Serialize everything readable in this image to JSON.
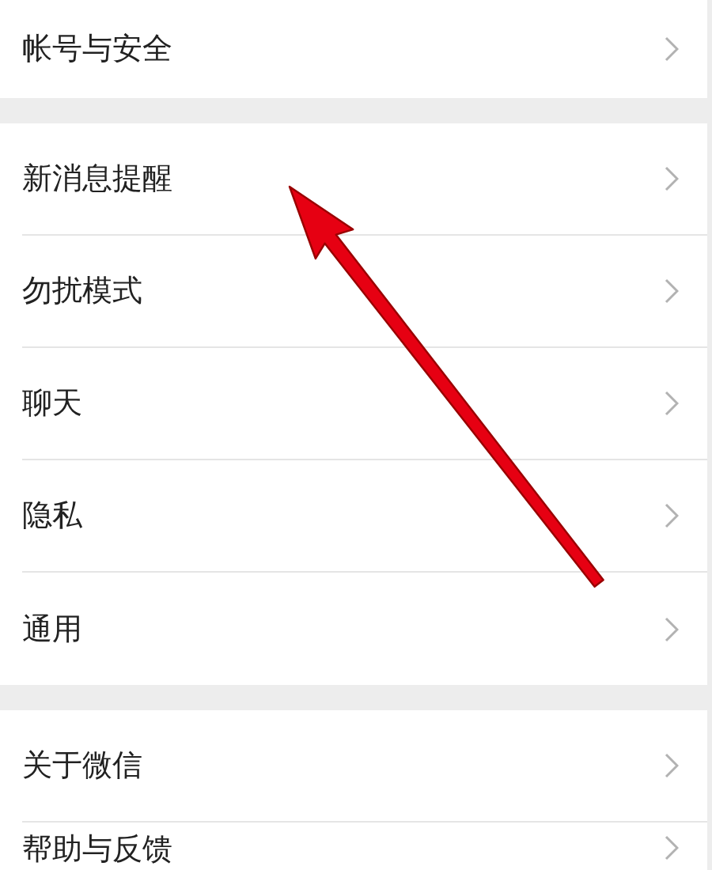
{
  "groups": [
    {
      "items": [
        {
          "label": "帐号与安全"
        }
      ]
    },
    {
      "items": [
        {
          "label": "新消息提醒"
        },
        {
          "label": "勿扰模式"
        },
        {
          "label": "聊天"
        },
        {
          "label": "隐私"
        },
        {
          "label": "通用"
        }
      ]
    },
    {
      "items": [
        {
          "label": "关于微信"
        },
        {
          "label": "帮助与反馈"
        }
      ]
    }
  ],
  "annotation": {
    "kind": "arrow"
  }
}
